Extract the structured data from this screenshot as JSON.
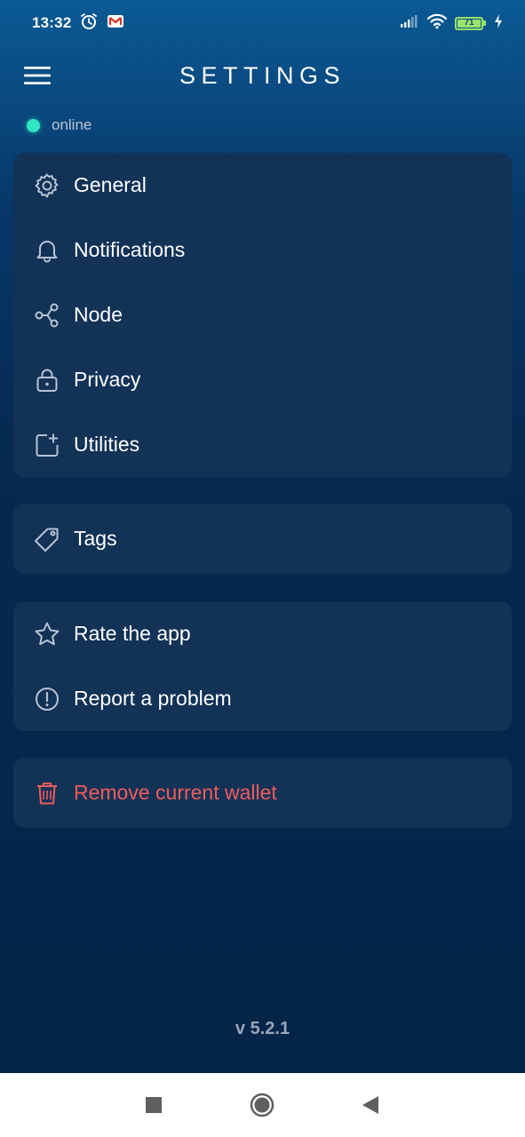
{
  "status_bar": {
    "time": "13:32",
    "battery": "71",
    "icons": [
      "alarm-icon",
      "gmail-icon",
      "signal-icon",
      "wifi-icon",
      "battery-icon",
      "charging-icon"
    ]
  },
  "header": {
    "title": "SETTINGS",
    "menu_icon": "hamburger-menu-icon"
  },
  "connection": {
    "status": "online",
    "color": "#2ee6c0"
  },
  "groups": [
    {
      "items": [
        {
          "label": "General",
          "icon": "gear-icon"
        },
        {
          "label": "Notifications",
          "icon": "bell-icon"
        },
        {
          "label": "Node",
          "icon": "share-nodes-icon"
        },
        {
          "label": "Privacy",
          "icon": "lock-icon"
        },
        {
          "label": "Utilities",
          "icon": "add-square-icon"
        }
      ]
    },
    {
      "items": [
        {
          "label": "Tags",
          "icon": "tag-icon"
        }
      ]
    },
    {
      "items": [
        {
          "label": "Rate the app",
          "icon": "star-icon"
        },
        {
          "label": "Report a problem",
          "icon": "alert-circle-icon"
        }
      ]
    },
    {
      "items": [
        {
          "label": "Remove current wallet",
          "icon": "trash-icon",
          "color": "#ef5c5c"
        }
      ]
    }
  ],
  "footer": {
    "version": "v 5.2.1"
  },
  "nav_bar": {
    "buttons": [
      "recents-square-icon",
      "home-circle-icon",
      "back-triangle-icon"
    ]
  },
  "colors": {
    "accent": "#2ee6c0",
    "card": "#123256",
    "danger": "#ef5c5c"
  }
}
